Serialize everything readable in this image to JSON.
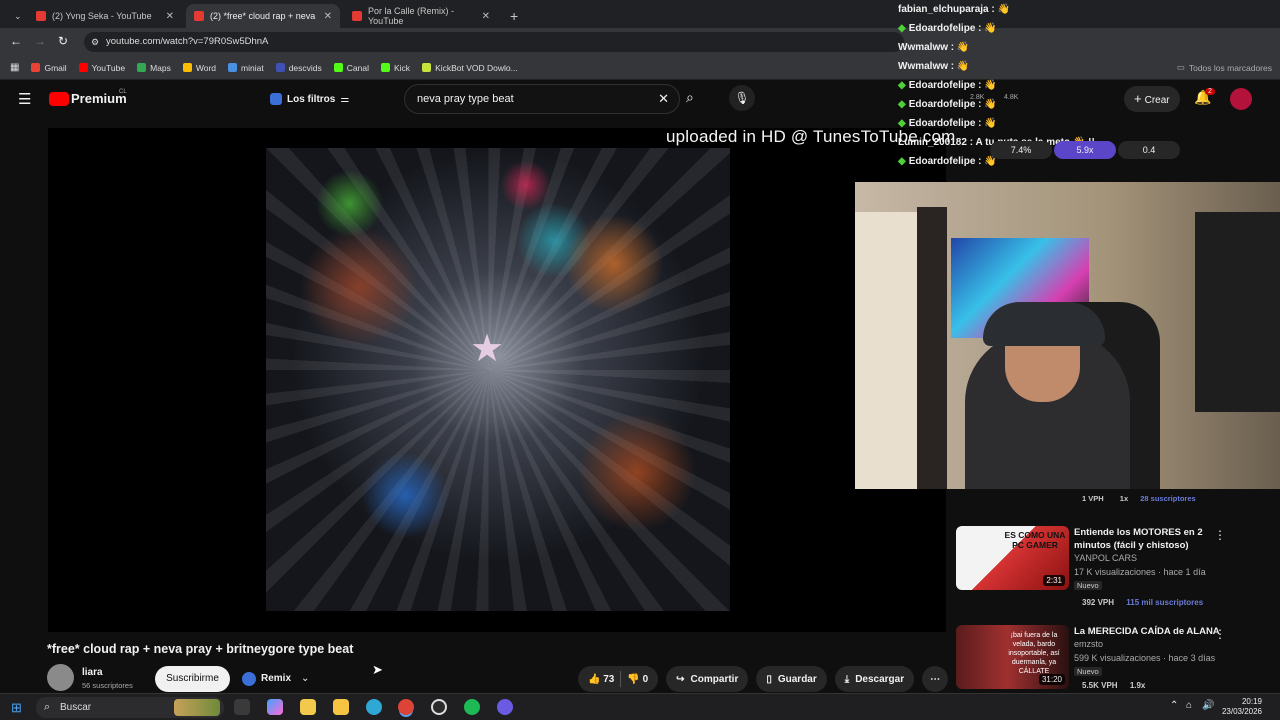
{
  "browser": {
    "tabs": [
      {
        "label": "(2) Yvng Seka - YouTube"
      },
      {
        "label": "(2) *free* cloud rap + neva"
      },
      {
        "label": "Por la Calle (Remix) - YouTube"
      }
    ],
    "url": "youtube.com/watch?v=79R0Sw5DhnA",
    "bookmarks": [
      "Gmail",
      "YouTube",
      "Maps",
      "Word",
      "miniat",
      "descvids",
      "Canal",
      "Kick",
      "KickBot VOD Dowlo..."
    ],
    "bookmarks_folder": "Todos los marcadores"
  },
  "youtube": {
    "logo": "Premium",
    "logo_region": "CL",
    "filters_label": "Los filtros",
    "search_value": "neva pray type beat",
    "create_label": "Crear",
    "notif_count": "2",
    "stats_left": "2.8K",
    "stats_right": "4.8K"
  },
  "overlay_text": "uploaded in HD @ TunesToTube.com",
  "chat": [
    {
      "user": "fabian_elchuparaja :",
      "badge": false
    },
    {
      "user": "Edoardofelipe :",
      "badge": true
    },
    {
      "user": "Wwmalww :",
      "badge": false
    },
    {
      "user": "Wwmalww :",
      "badge": false
    },
    {
      "user": "Edoardofelipe :",
      "badge": true
    },
    {
      "user": "Edoardofelipe :",
      "badge": true
    },
    {
      "user": "Edoardofelipe :",
      "badge": true
    },
    {
      "user": "Lumin_200182 :",
      "badge": false,
      "msg": "A tu puta se la meto 👋 !!"
    },
    {
      "user": "Edoardofelipe :",
      "badge": true
    }
  ],
  "chips": [
    "7.4%",
    "5.9x",
    "0.4"
  ],
  "video": {
    "title": "*free* cloud rap + neva pray + britneygore type beat",
    "channel": "liara",
    "subscribers": "56 suscriptores",
    "subscribe_label": "Suscribirme",
    "remix_label": "Remix",
    "likes": "73",
    "dislikes": "0",
    "share_label": "Compartir",
    "save_label": "Guardar",
    "download_label": "Descargar"
  },
  "cam_caption": {
    "vph": "1 VPH",
    "mult": "1x",
    "subs": "28 suscriptores"
  },
  "recommendations": [
    {
      "title": "Entiende los MOTORES en 2 minutos (fácil y chistoso)",
      "channel": "YANPOL CARS",
      "meta": "17 K visualizaciones · hace 1 día",
      "badge": "Nuevo",
      "duration": "2:31",
      "vph": "392 VPH",
      "subs": "115 mil suscriptores",
      "thumb_text": "ES COMO UNA PC GAMER"
    },
    {
      "title": "La MERECIDA CAÍDA de ALANA",
      "channel": "emzsto",
      "meta": "599 K visualizaciones · hace 3 días",
      "badge": "Nuevo",
      "duration": "31:20",
      "vph": "5.5K VPH",
      "mult": "1.9x",
      "thumb_text": "¡bai fuera de la velada, bardo insoportable, así duermanla, ya CÁLLATE"
    }
  ],
  "taskbar": {
    "search_label": "Buscar",
    "time": "20:19",
    "date": "23/03/2026"
  }
}
